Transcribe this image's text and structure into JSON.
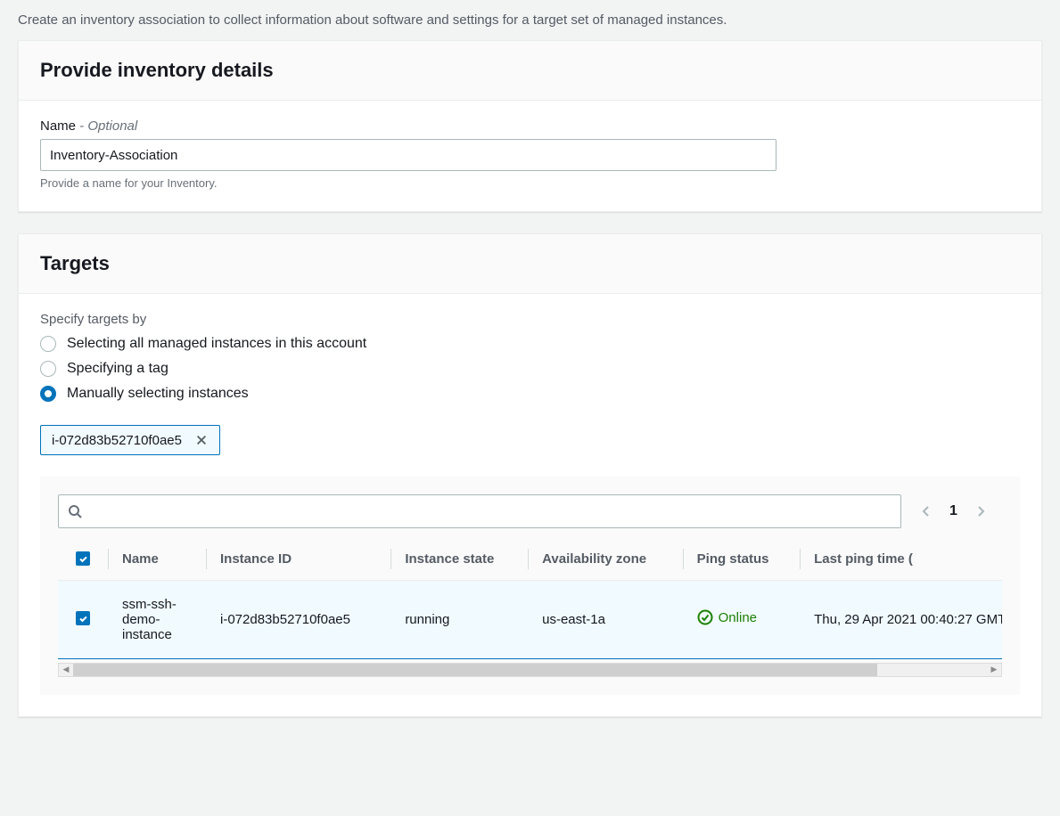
{
  "page_description": "Create an inventory association to collect information about software and settings for a target set of managed instances.",
  "details_panel": {
    "title": "Provide inventory details",
    "name_label": "Name",
    "name_optional": " - Optional",
    "name_value": "Inventory-Association",
    "name_hint": "Provide a name for your Inventory."
  },
  "targets_panel": {
    "title": "Targets",
    "specify_label": "Specify targets by",
    "radios": {
      "all": "Selecting all managed instances in this account",
      "tag": "Specifying a tag",
      "manual": "Manually selecting instances"
    },
    "selected_radio": "manual",
    "token": "i-072d83b52710f0ae5",
    "search_placeholder": "",
    "pagination": {
      "current": "1"
    },
    "columns": {
      "name": "Name",
      "instance_id": "Instance ID",
      "state": "Instance state",
      "az": "Availability zone",
      "ping": "Ping status",
      "last_ping": "Last ping time ("
    },
    "rows": [
      {
        "checked": true,
        "name": "ssm-ssh-demo-instance",
        "instance_id": "i-072d83b52710f0ae5",
        "state": "running",
        "az": "us-east-1a",
        "ping": "Online",
        "last_ping": "Thu, 29 Apr 2021 00:40:27 GMT"
      }
    ]
  }
}
